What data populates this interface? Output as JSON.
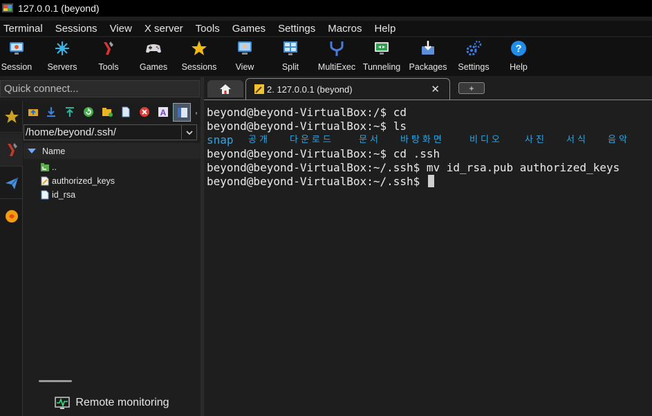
{
  "window": {
    "title": "127.0.0.1 (beyond)"
  },
  "menu": [
    "Terminal",
    "Sessions",
    "View",
    "X server",
    "Tools",
    "Games",
    "Settings",
    "Macros",
    "Help"
  ],
  "toolbar": [
    {
      "label": "Session",
      "icon": "session-monitor-icon"
    },
    {
      "label": "Servers",
      "icon": "servers-icon"
    },
    {
      "label": "Tools",
      "icon": "tools-icon"
    },
    {
      "label": "Games",
      "icon": "gamepad-icon"
    },
    {
      "label": "Sessions",
      "icon": "star-icon"
    },
    {
      "label": "View",
      "icon": "view-icon"
    },
    {
      "label": "Split",
      "icon": "split-icon"
    },
    {
      "label": "MultiExec",
      "icon": "multiexec-icon"
    },
    {
      "label": "Tunneling",
      "icon": "tunneling-icon"
    },
    {
      "label": "Packages",
      "icon": "packages-icon"
    },
    {
      "label": "Settings",
      "icon": "gears-icon"
    },
    {
      "label": "Help",
      "icon": "help-icon"
    }
  ],
  "quick_connect": {
    "placeholder": "Quick connect..."
  },
  "sftp": {
    "path": "/home/beyond/.ssh/",
    "column_header": "Name",
    "files": [
      {
        "name": "..",
        "icon": "parent-folder-icon"
      },
      {
        "name": "authorized_keys",
        "icon": "text-file-icon"
      },
      {
        "name": "id_rsa",
        "icon": "file-icon"
      }
    ],
    "remote_monitoring": "Remote monitoring"
  },
  "tabs": {
    "active_label": "2. 127.0.0.1 (beyond)",
    "close": "✕",
    "add": "+"
  },
  "terminal": {
    "lines": [
      "beyond@beyond-VirtualBox:/$ cd",
      "beyond@beyond-VirtualBox:~$ ls"
    ],
    "ls_output": [
      "snap",
      "공개",
      "다운로드",
      "문서",
      "바탕화면",
      "비디오",
      "사진",
      "서식",
      "음악"
    ],
    "lines_after": [
      "beyond@beyond-VirtualBox:~$ cd .ssh",
      "beyond@beyond-VirtualBox:~/.ssh$ mv id_rsa.pub authorized_keys"
    ],
    "prompt": "beyond@beyond-VirtualBox:~/.ssh$ "
  },
  "colors": {
    "ls_dir": "#2aa7e8",
    "background": "#1e1e1e",
    "accent_blue": "#6fa8ff"
  }
}
